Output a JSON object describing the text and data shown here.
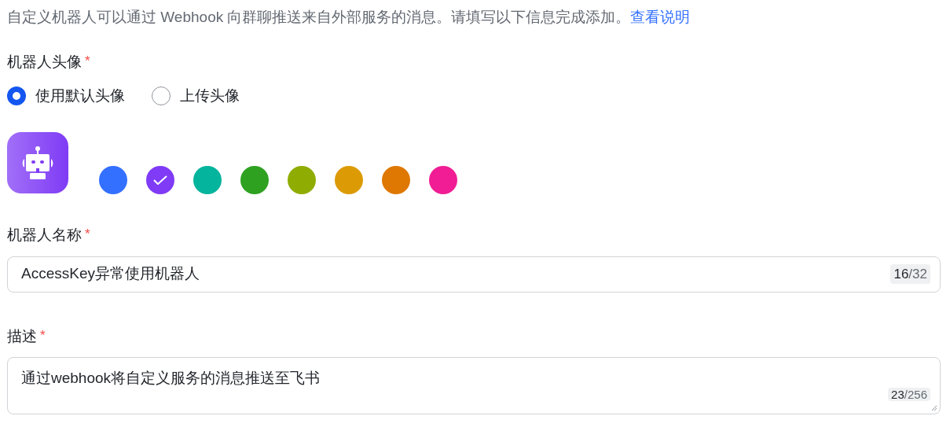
{
  "intro": {
    "text": "自定义机器人可以通过 Webhook 向群聊推送来自外部服务的消息。请填写以下信息完成添加。",
    "link": "查看说明"
  },
  "avatar": {
    "label": "机器人头像",
    "required_mark": "*",
    "options": [
      {
        "label": "使用默认头像",
        "selected": true
      },
      {
        "label": "上传头像",
        "selected": false
      }
    ],
    "colors": [
      {
        "color": "#3370ff",
        "selected": false
      },
      {
        "color": "#7f3bf5",
        "selected": true
      },
      {
        "color": "#04b49c",
        "selected": false
      },
      {
        "color": "#2ea121",
        "selected": false
      },
      {
        "color": "#8fac02",
        "selected": false
      },
      {
        "color": "#dc9b04",
        "selected": false
      },
      {
        "color": "#de7802",
        "selected": false
      },
      {
        "color": "#f01d94",
        "selected": false
      }
    ]
  },
  "name": {
    "label": "机器人名称",
    "required_mark": "*",
    "value": "AccessKey异常使用机器人",
    "count": "16",
    "limit": "/32"
  },
  "description": {
    "label": "描述",
    "required_mark": "*",
    "value": "通过webhook将自定义服务的消息推送至飞书",
    "count": "23",
    "limit": "/256"
  }
}
